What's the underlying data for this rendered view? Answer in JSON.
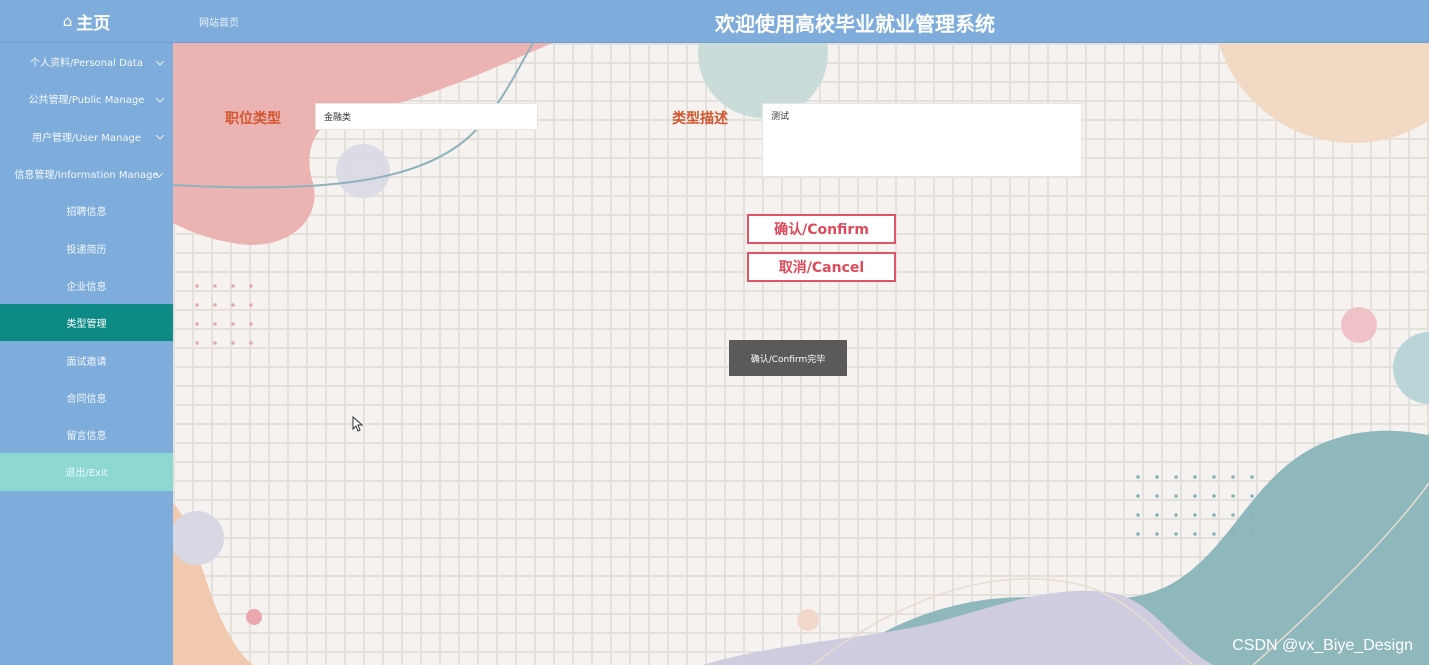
{
  "header": {
    "home_label": "主页",
    "home_icon": "home-icon",
    "site_home": "网站首页",
    "title": "欢迎使用高校毕业就业管理系统"
  },
  "sidebar": {
    "items": [
      {
        "label": "个人资料/Personal Data",
        "expandable": true
      },
      {
        "label": "公共管理/Public Manage",
        "expandable": true
      },
      {
        "label": "用户管理/User Manage",
        "expandable": true
      },
      {
        "label": "信息管理/Information Manage",
        "expandable": true
      },
      {
        "label": "招聘信息"
      },
      {
        "label": "投递简历"
      },
      {
        "label": "企业信息"
      },
      {
        "label": "类型管理",
        "active": true
      },
      {
        "label": "面试邀请"
      },
      {
        "label": "合同信息"
      },
      {
        "label": "留言信息"
      },
      {
        "label": "退出/Exit",
        "exit": true
      }
    ]
  },
  "form": {
    "position_type_label": "职位类型",
    "position_type_value": "金融类",
    "type_desc_label": "类型描述",
    "type_desc_value": "测试",
    "confirm_label": "确认/Confirm",
    "cancel_label": "取消/Cancel",
    "confirm_done_label": "确认/Confirm完毕"
  },
  "watermark": "CSDN @vx_Biye_Design",
  "colors": {
    "sidebar": "#7eacdb",
    "active": "#0e8a86",
    "exit": "#8ed8d2",
    "label": "#d4562f",
    "button_border": "#e05566"
  }
}
